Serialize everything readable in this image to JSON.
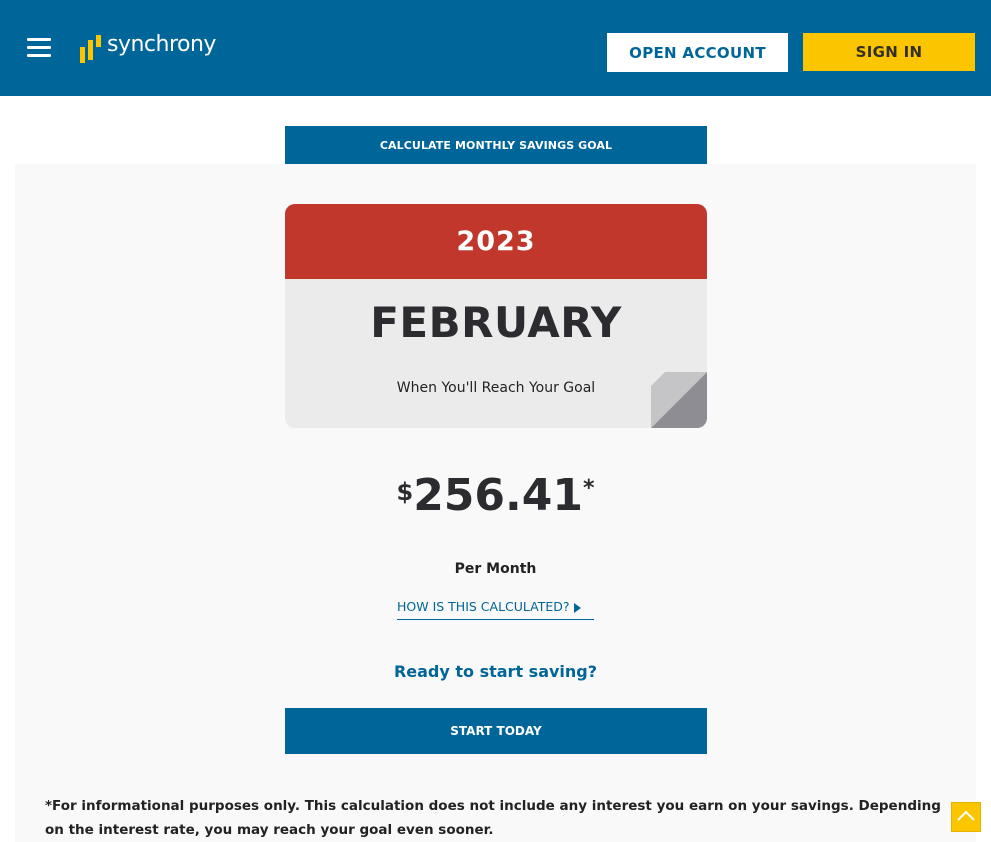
{
  "header": {
    "logo_text": "synchrony",
    "open_account_label": "OPEN ACCOUNT",
    "sign_in_label": "SIGN IN",
    "menu_icon": "hamburger-menu-icon"
  },
  "calculator": {
    "tab_label": "CALCULATE MONTHLY SAVINGS GOAL",
    "year": "2023",
    "month": "FEBRUARY",
    "month_sub": "When You'll Reach Your Goal",
    "currency": "$",
    "amount": "256.41",
    "asterisk": "*",
    "per_month": "Per Month",
    "how_link": "HOW IS THIS CALCULATED?",
    "ready_text": "Ready to start saving?",
    "start_label": "START TODAY",
    "disclaimer": "*For informational purposes only. This calculation does not include any interest you earn on your savings. Depending on the interest rate, you may reach your goal even sooner."
  },
  "colors": {
    "brand_blue": "#006599",
    "brand_yellow": "#fbc600",
    "calendar_red": "#c1372b"
  }
}
